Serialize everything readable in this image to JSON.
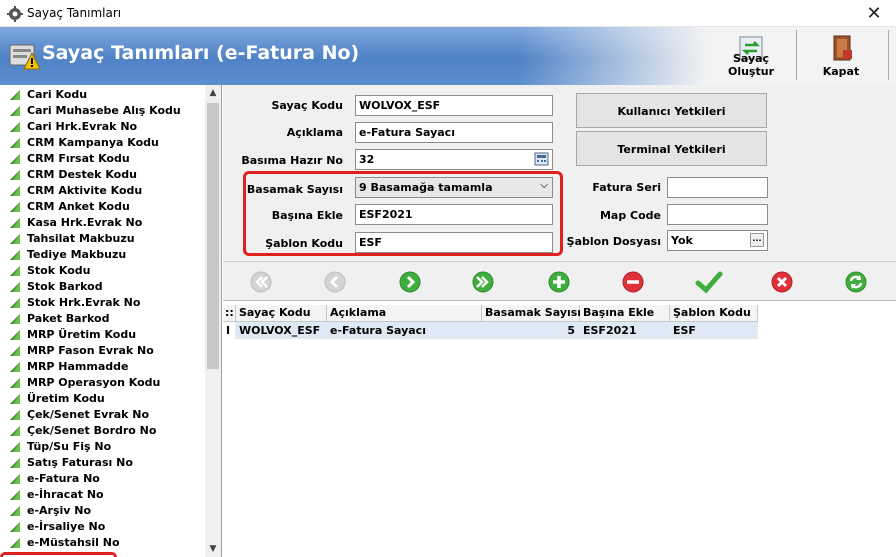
{
  "window": {
    "title": "Sayaç Tanımları",
    "close_symbol": "✕"
  },
  "header": {
    "title": "Sayaç Tanımları (e-Fatura No)",
    "buttons": {
      "create_counter": "Sayaç Oluştur",
      "close": "Kapat"
    }
  },
  "sidebar": {
    "selected": "e-Fatura No",
    "items": [
      "Cari Kodu",
      "Cari Muhasebe Alış Kodu",
      "Cari Hrk.Evrak No",
      "CRM Kampanya Kodu",
      "CRM Fırsat Kodu",
      "CRM Destek Kodu",
      "CRM Aktivite Kodu",
      "CRM Anket Kodu",
      "Kasa Hrk.Evrak No",
      "Tahsilat Makbuzu",
      "Tediye Makbuzu",
      "Stok Kodu",
      "Stok Barkod",
      "Stok Hrk.Evrak No",
      "Paket Barkod",
      "MRP Üretim Kodu",
      "MRP Fason Evrak No",
      "MRP Hammadde",
      "MRP Operasyon Kodu",
      "Üretim Kodu",
      "Çek/Senet Evrak No",
      "Çek/Senet Bordro No",
      "Tüp/Su Fiş No",
      "Satış Faturası No",
      "e-Fatura No",
      "e-İhracat No",
      "e-Arşiv No",
      "e-İrsaliye No",
      "e-Müstahsil No"
    ]
  },
  "form": {
    "sayac_kodu": {
      "label": "Sayaç Kodu",
      "value": "WOLVOX_ESF"
    },
    "aciklama": {
      "label": "Açıklama",
      "value": "e-Fatura Sayacı"
    },
    "basima_hazir_no": {
      "label": "Basıma Hazır No",
      "value": "32"
    },
    "basamak_sayisi": {
      "label": "Basamak Sayısı",
      "value": "9 Basamağa tamamla"
    },
    "basina_ekle": {
      "label": "Başına Ekle",
      "value": "ESF2021"
    },
    "sablon_kodu": {
      "label": "Şablon Kodu",
      "value": "ESF"
    },
    "fatura_seri": {
      "label": "Fatura Seri",
      "value": ""
    },
    "map_code": {
      "label": "Map Code",
      "value": ""
    },
    "sablon_dosyasi": {
      "label": "Şablon Dosyası",
      "value": "Yok"
    },
    "buttons": {
      "user_rights": "Kullanıcı Yetkileri",
      "terminal_rights": "Terminal Yetkileri"
    }
  },
  "nav_toolbar": [
    "first-icon",
    "previous-icon",
    "next-icon",
    "last-icon",
    "add-icon",
    "delete-icon",
    "save-icon",
    "cancel-icon",
    "refresh-icon"
  ],
  "grid": {
    "headers": [
      "Sayaç Kodu",
      "Açıklama",
      "Basamak Sayısı",
      "Başına Ekle",
      "Şablon Kodu"
    ],
    "rows": [
      {
        "sayac_kodu": "WOLVOX_ESF",
        "aciklama": "e-Fatura Sayacı",
        "basamak_sayisi": "5",
        "basina_ekle": "ESF2021",
        "sablon_kodu": "ESF"
      }
    ]
  },
  "colors": {
    "highlight": "#e02020",
    "banner": "#4f82c6",
    "row_selected": "#dfe9f5"
  }
}
